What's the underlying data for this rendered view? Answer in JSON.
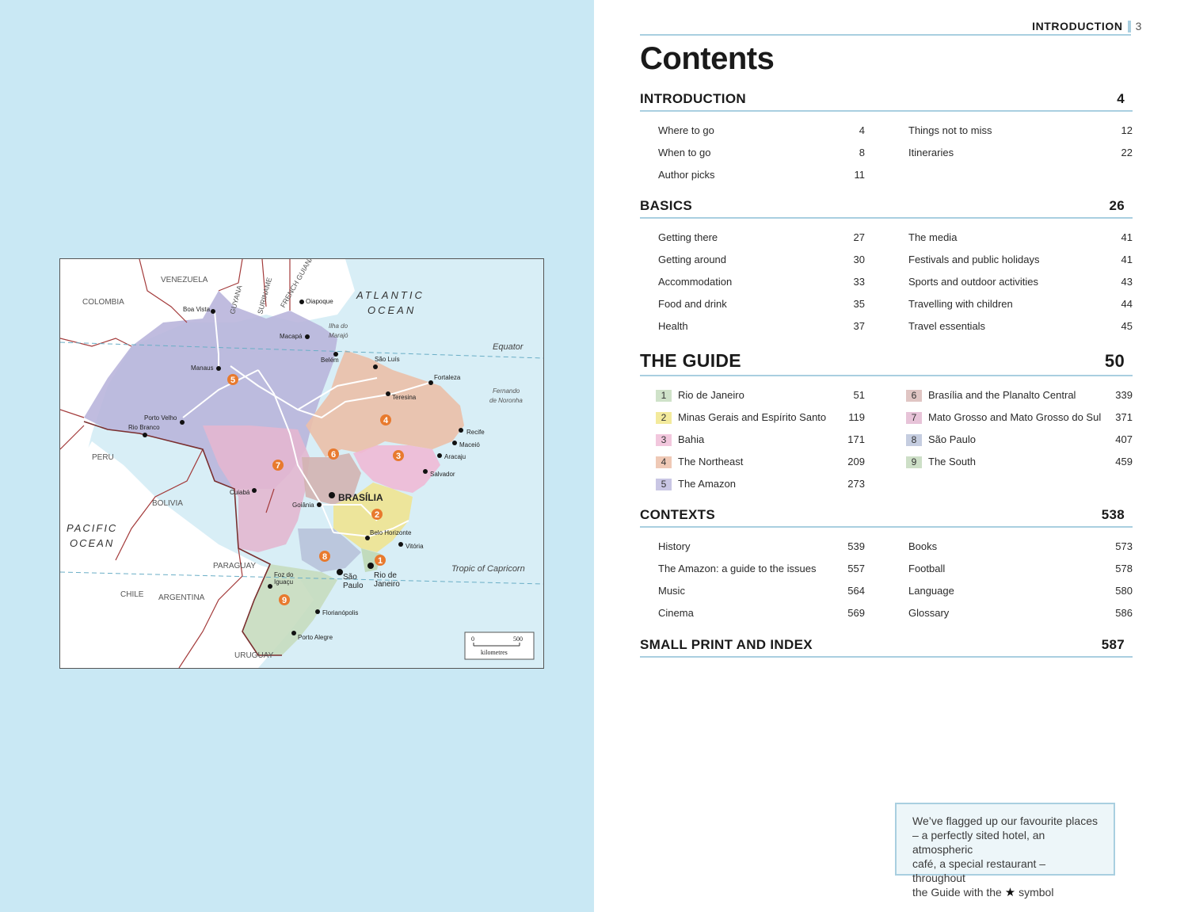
{
  "map": {
    "labels": {
      "venezuela": "VENEZUELA",
      "colombia": "COLOMBIA",
      "guyana": "GUYANA",
      "suriname": "SURINAME",
      "french_guiana": "FRENCH GUIANA",
      "atlantic": "ATLANTIC",
      "ocean1": "OCEAN",
      "pacific": "PACIFIC",
      "ocean2": "OCEAN",
      "peru": "PERU",
      "bolivia": "BOLIVIA",
      "paraguay": "PARAGUAY",
      "chile": "CHILE",
      "argentina": "ARGENTINA",
      "uruguay": "URUGUAY",
      "equator": "Equator",
      "tropic": "Tropic of Capricorn",
      "fernando": "Fernando",
      "noronha": "de Noronha",
      "ilha": "Ilha do",
      "marajo": "Marajó"
    },
    "cities": {
      "boa_vista": "Boa Vista",
      "oiapoque": "Oiapoque",
      "macapa": "Macapá",
      "belem": "Belém",
      "sao_luis": "São Luís",
      "fortaleza": "Fortaleza",
      "teresina": "Teresina",
      "manaus": "Manaus",
      "porto_velho": "Porto Velho",
      "rio_branco": "Rio Branco",
      "recife": "Recife",
      "maceio": "Maceió",
      "aracaju": "Aracaju",
      "salvador": "Salvador",
      "cuiaba": "Cuiabá",
      "brasilia": "BRASÍLIA",
      "goiania": "Goiânia",
      "belo_horizonte": "Belo Horizonte",
      "vitoria": "Vitória",
      "sao": "São",
      "paulo": "Paulo",
      "rio_de": "Rio de",
      "janeiro": "Janeiro",
      "foz_do": "Foz do",
      "iguacu": "Iguaçu",
      "florianopolis": "Florianópolis",
      "porto_alegre": "Porto Alegre"
    },
    "region_markers": [
      "1",
      "2",
      "3",
      "4",
      "5",
      "6",
      "7",
      "8",
      "9"
    ],
    "scale": {
      "zero": "0",
      "max": "500",
      "unit": "kilometres"
    }
  },
  "header": {
    "section": "INTRODUCTION",
    "page": "3"
  },
  "title": "Contents",
  "sections": {
    "introduction": {
      "title": "INTRODUCTION",
      "page": "4",
      "left": [
        {
          "label": "Where to go",
          "page": "4"
        },
        {
          "label": "When to go",
          "page": "8"
        },
        {
          "label": "Author picks",
          "page": "11"
        }
      ],
      "right": [
        {
          "label": "Things not to miss",
          "page": "12"
        },
        {
          "label": "Itineraries",
          "page": "22"
        }
      ]
    },
    "basics": {
      "title": "BASICS",
      "page": "26",
      "left": [
        {
          "label": "Getting there",
          "page": "27"
        },
        {
          "label": "Getting around",
          "page": "30"
        },
        {
          "label": "Accommodation",
          "page": "33"
        },
        {
          "label": "Food and drink",
          "page": "35"
        },
        {
          "label": "Health",
          "page": "37"
        }
      ],
      "right": [
        {
          "label": "The media",
          "page": "41"
        },
        {
          "label": "Festivals and public holidays",
          "page": "41"
        },
        {
          "label": "Sports and outdoor activities",
          "page": "43"
        },
        {
          "label": "Travelling with children",
          "page": "44"
        },
        {
          "label": "Travel essentials",
          "page": "45"
        }
      ]
    },
    "guide": {
      "title": "THE GUIDE",
      "page": "50",
      "left": [
        {
          "num": "1",
          "label": "Rio de Janeiro",
          "page": "51",
          "color": "#cfe2c9"
        },
        {
          "num": "2",
          "label": "Minas Gerais and Espírito Santo",
          "page": "119",
          "color": "#f3ea9c"
        },
        {
          "num": "3",
          "label": "Bahia",
          "page": "171",
          "color": "#f2c7dd"
        },
        {
          "num": "4",
          "label": "The Northeast",
          "page": "209",
          "color": "#efc9b6"
        },
        {
          "num": "5",
          "label": "The Amazon",
          "page": "273",
          "color": "#c9c6e4"
        }
      ],
      "right": [
        {
          "num": "6",
          "label": "Brasília and the Planalto Central",
          "page": "339",
          "color": "#e0c5c3"
        },
        {
          "num": "7",
          "label": "Mato Grosso and Mato Grosso do Sul",
          "page": "371",
          "color": "#e7c3d8"
        },
        {
          "num": "8",
          "label": "São Paulo",
          "page": "407",
          "color": "#c5cde0"
        },
        {
          "num": "9",
          "label": "The South",
          "page": "459",
          "color": "#cddfc7"
        }
      ]
    },
    "contexts": {
      "title": "CONTEXTS",
      "page": "538",
      "left": [
        {
          "label": "History",
          "page": "539"
        },
        {
          "label": "The Amazon: a guide to the issues",
          "page": "557"
        },
        {
          "label": "Music",
          "page": "564"
        },
        {
          "label": "Cinema",
          "page": "569"
        }
      ],
      "right": [
        {
          "label": "Books",
          "page": "573"
        },
        {
          "label": "Football",
          "page": "578"
        },
        {
          "label": "Language",
          "page": "580"
        },
        {
          "label": "Glossary",
          "page": "586"
        }
      ]
    },
    "smallprint": {
      "title": "SMALL PRINT AND INDEX",
      "page": "587"
    }
  },
  "note": {
    "line1": "We’ve flagged up our favourite places",
    "line2": "– a perfectly sited hotel, an atmospheric",
    "line3": "café, a special restaurant – throughout",
    "line4_pre": "the Guide with the",
    "line4_post": "symbol",
    "icon": "star-icon"
  },
  "colors": {
    "page_bg": "#c9e8f4",
    "rule": "#a9cfe0",
    "marker": "#e87a2e",
    "sea": "#dcf0f7"
  }
}
